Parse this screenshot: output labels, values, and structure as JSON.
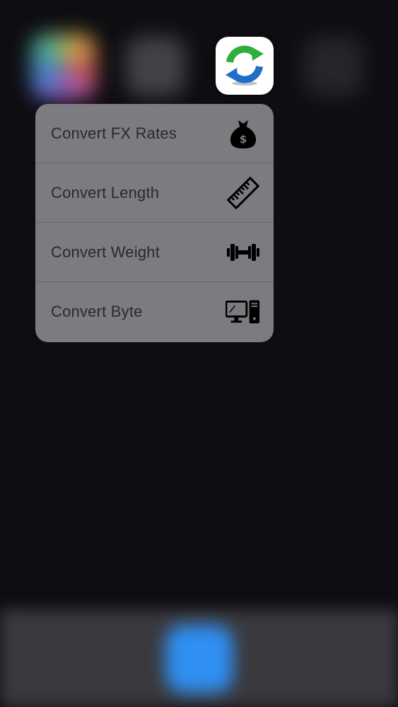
{
  "app": {
    "icon": "refresh-arrows-icon",
    "colors": {
      "arrow_green": "#2fae3b",
      "arrow_blue": "#1f6fc9"
    }
  },
  "quick_actions": [
    {
      "label": "Convert FX Rates",
      "icon": "money-bag-icon"
    },
    {
      "label": "Convert Length",
      "icon": "ruler-icon"
    },
    {
      "label": "Convert Weight",
      "icon": "dumbbell-icon"
    },
    {
      "label": "Convert Byte",
      "icon": "computer-icon"
    }
  ],
  "colors": {
    "background": "#0e0d11",
    "menu_background": "#7c7b80",
    "menu_text": "#2a2a2d",
    "dock_icon": "#2f8ff2"
  }
}
